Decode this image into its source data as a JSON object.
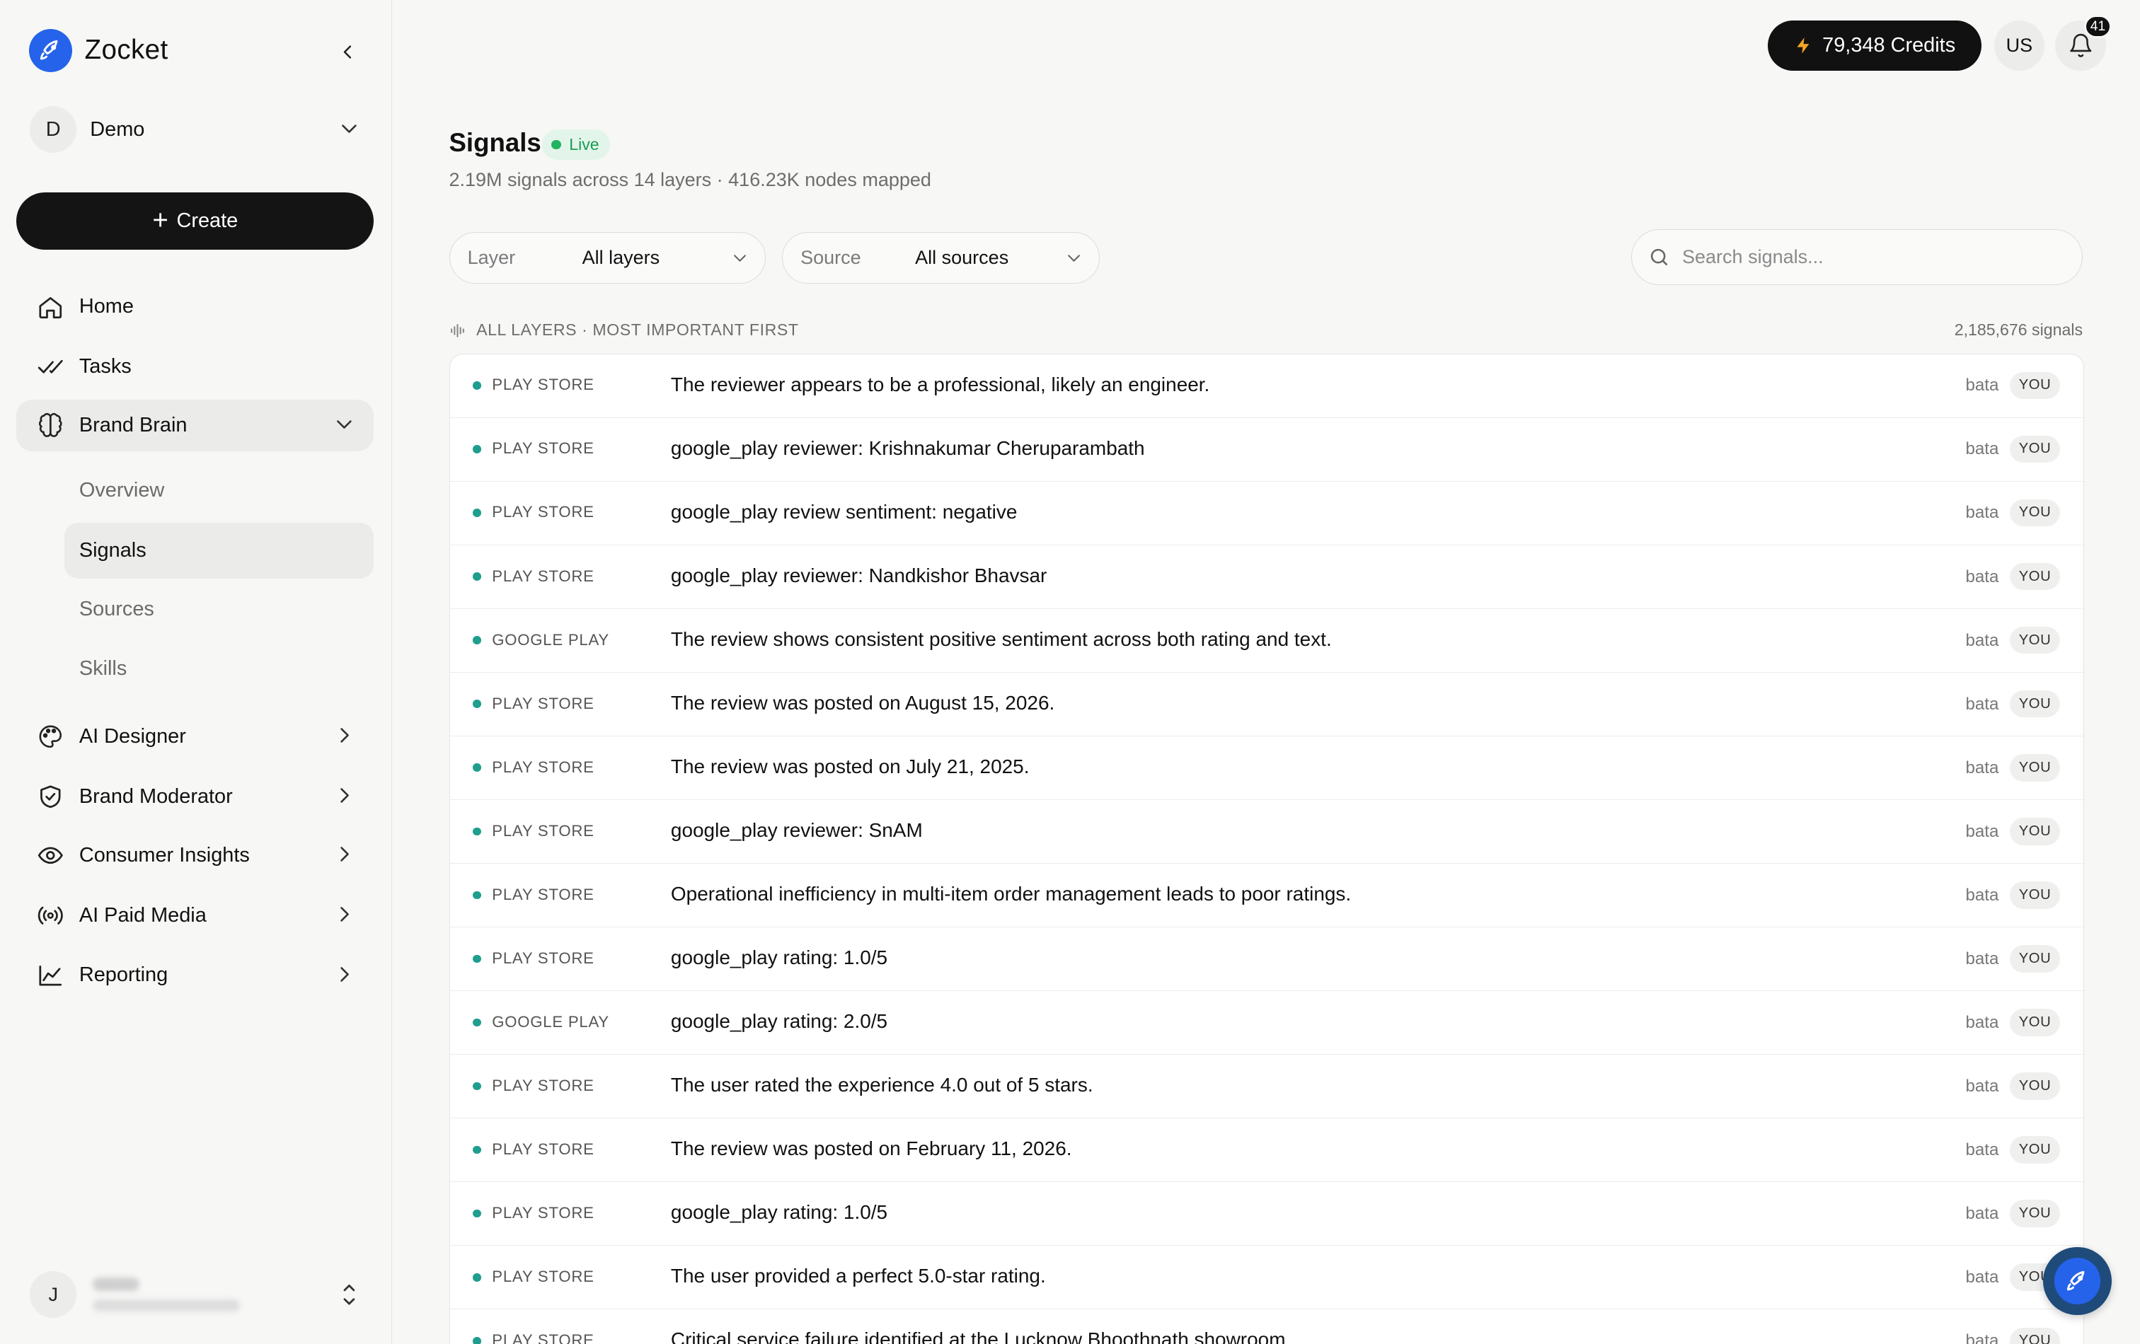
{
  "app": {
    "name": "Zocket",
    "colors": {
      "brand": "#2563eb",
      "accent_dark": "#111111",
      "live_green": "#22b460",
      "signal_dot": "#1f9e8f"
    }
  },
  "sidebar": {
    "workspace": {
      "initial": "D",
      "name": "Demo"
    },
    "create_label": "Create",
    "nav": [
      {
        "icon": "home-icon",
        "label": "Home"
      },
      {
        "icon": "check-double-icon",
        "label": "Tasks"
      },
      {
        "icon": "brain-icon",
        "label": "Brand Brain",
        "expanded": true
      },
      {
        "icon": "palette-icon",
        "label": "AI Designer"
      },
      {
        "icon": "shield-check-icon",
        "label": "Brand Moderator"
      },
      {
        "icon": "eye-icon",
        "label": "Consumer Insights"
      },
      {
        "icon": "broadcast-icon",
        "label": "AI Paid Media"
      },
      {
        "icon": "chart-line-icon",
        "label": "Reporting"
      }
    ],
    "brand_brain_items": [
      "Overview",
      "Signals",
      "Sources",
      "Skills"
    ],
    "active_sub_item": "Signals",
    "user": {
      "initial": "J"
    }
  },
  "topbar": {
    "credits_label": "79,348 Credits",
    "region": "US",
    "notification_count": "41"
  },
  "main": {
    "title": "Signals",
    "live_label": "Live",
    "subtitle": "2.19M signals across 14 layers · 416.23K nodes mapped",
    "filters": {
      "layer": {
        "label": "Layer",
        "value": "All layers"
      },
      "source": {
        "label": "Source",
        "value": "All sources"
      }
    },
    "search_placeholder": "Search signals...",
    "list_heading": "ALL LAYERS · MOST IMPORTANT FIRST",
    "list_count": "2,185,676 signals",
    "signals": [
      {
        "source": "PLAY STORE",
        "text": "The reviewer appears to be a professional, likely an engineer.",
        "brand": "bata",
        "owner": "YOU"
      },
      {
        "source": "PLAY STORE",
        "text": "google_play reviewer: Krishnakumar Cheruparambath",
        "brand": "bata",
        "owner": "YOU"
      },
      {
        "source": "PLAY STORE",
        "text": "google_play review sentiment: negative",
        "brand": "bata",
        "owner": "YOU"
      },
      {
        "source": "PLAY STORE",
        "text": "google_play reviewer: Nandkishor Bhavsar",
        "brand": "bata",
        "owner": "YOU"
      },
      {
        "source": "GOOGLE PLAY",
        "text": "The review shows consistent positive sentiment across both rating and text.",
        "brand": "bata",
        "owner": "YOU"
      },
      {
        "source": "PLAY STORE",
        "text": "The review was posted on August 15, 2026.",
        "brand": "bata",
        "owner": "YOU"
      },
      {
        "source": "PLAY STORE",
        "text": "The review was posted on July 21, 2025.",
        "brand": "bata",
        "owner": "YOU"
      },
      {
        "source": "PLAY STORE",
        "text": "google_play reviewer: SnAM",
        "brand": "bata",
        "owner": "YOU"
      },
      {
        "source": "PLAY STORE",
        "text": "Operational inefficiency in multi-item order management leads to poor ratings.",
        "brand": "bata",
        "owner": "YOU"
      },
      {
        "source": "PLAY STORE",
        "text": "google_play rating: 1.0/5",
        "brand": "bata",
        "owner": "YOU"
      },
      {
        "source": "GOOGLE PLAY",
        "text": "google_play rating: 2.0/5",
        "brand": "bata",
        "owner": "YOU"
      },
      {
        "source": "PLAY STORE",
        "text": "The user rated the experience 4.0 out of 5 stars.",
        "brand": "bata",
        "owner": "YOU"
      },
      {
        "source": "PLAY STORE",
        "text": "The review was posted on February 11, 2026.",
        "brand": "bata",
        "owner": "YOU"
      },
      {
        "source": "PLAY STORE",
        "text": "google_play rating: 1.0/5",
        "brand": "bata",
        "owner": "YOU"
      },
      {
        "source": "PLAY STORE",
        "text": "The user provided a perfect 5.0-star rating.",
        "brand": "bata",
        "owner": "YOU"
      },
      {
        "source": "PLAY STORE",
        "text": "Critical service failure identified at the Lucknow Bhoothnath showroom.",
        "brand": "bata",
        "owner": "YOU"
      }
    ]
  }
}
